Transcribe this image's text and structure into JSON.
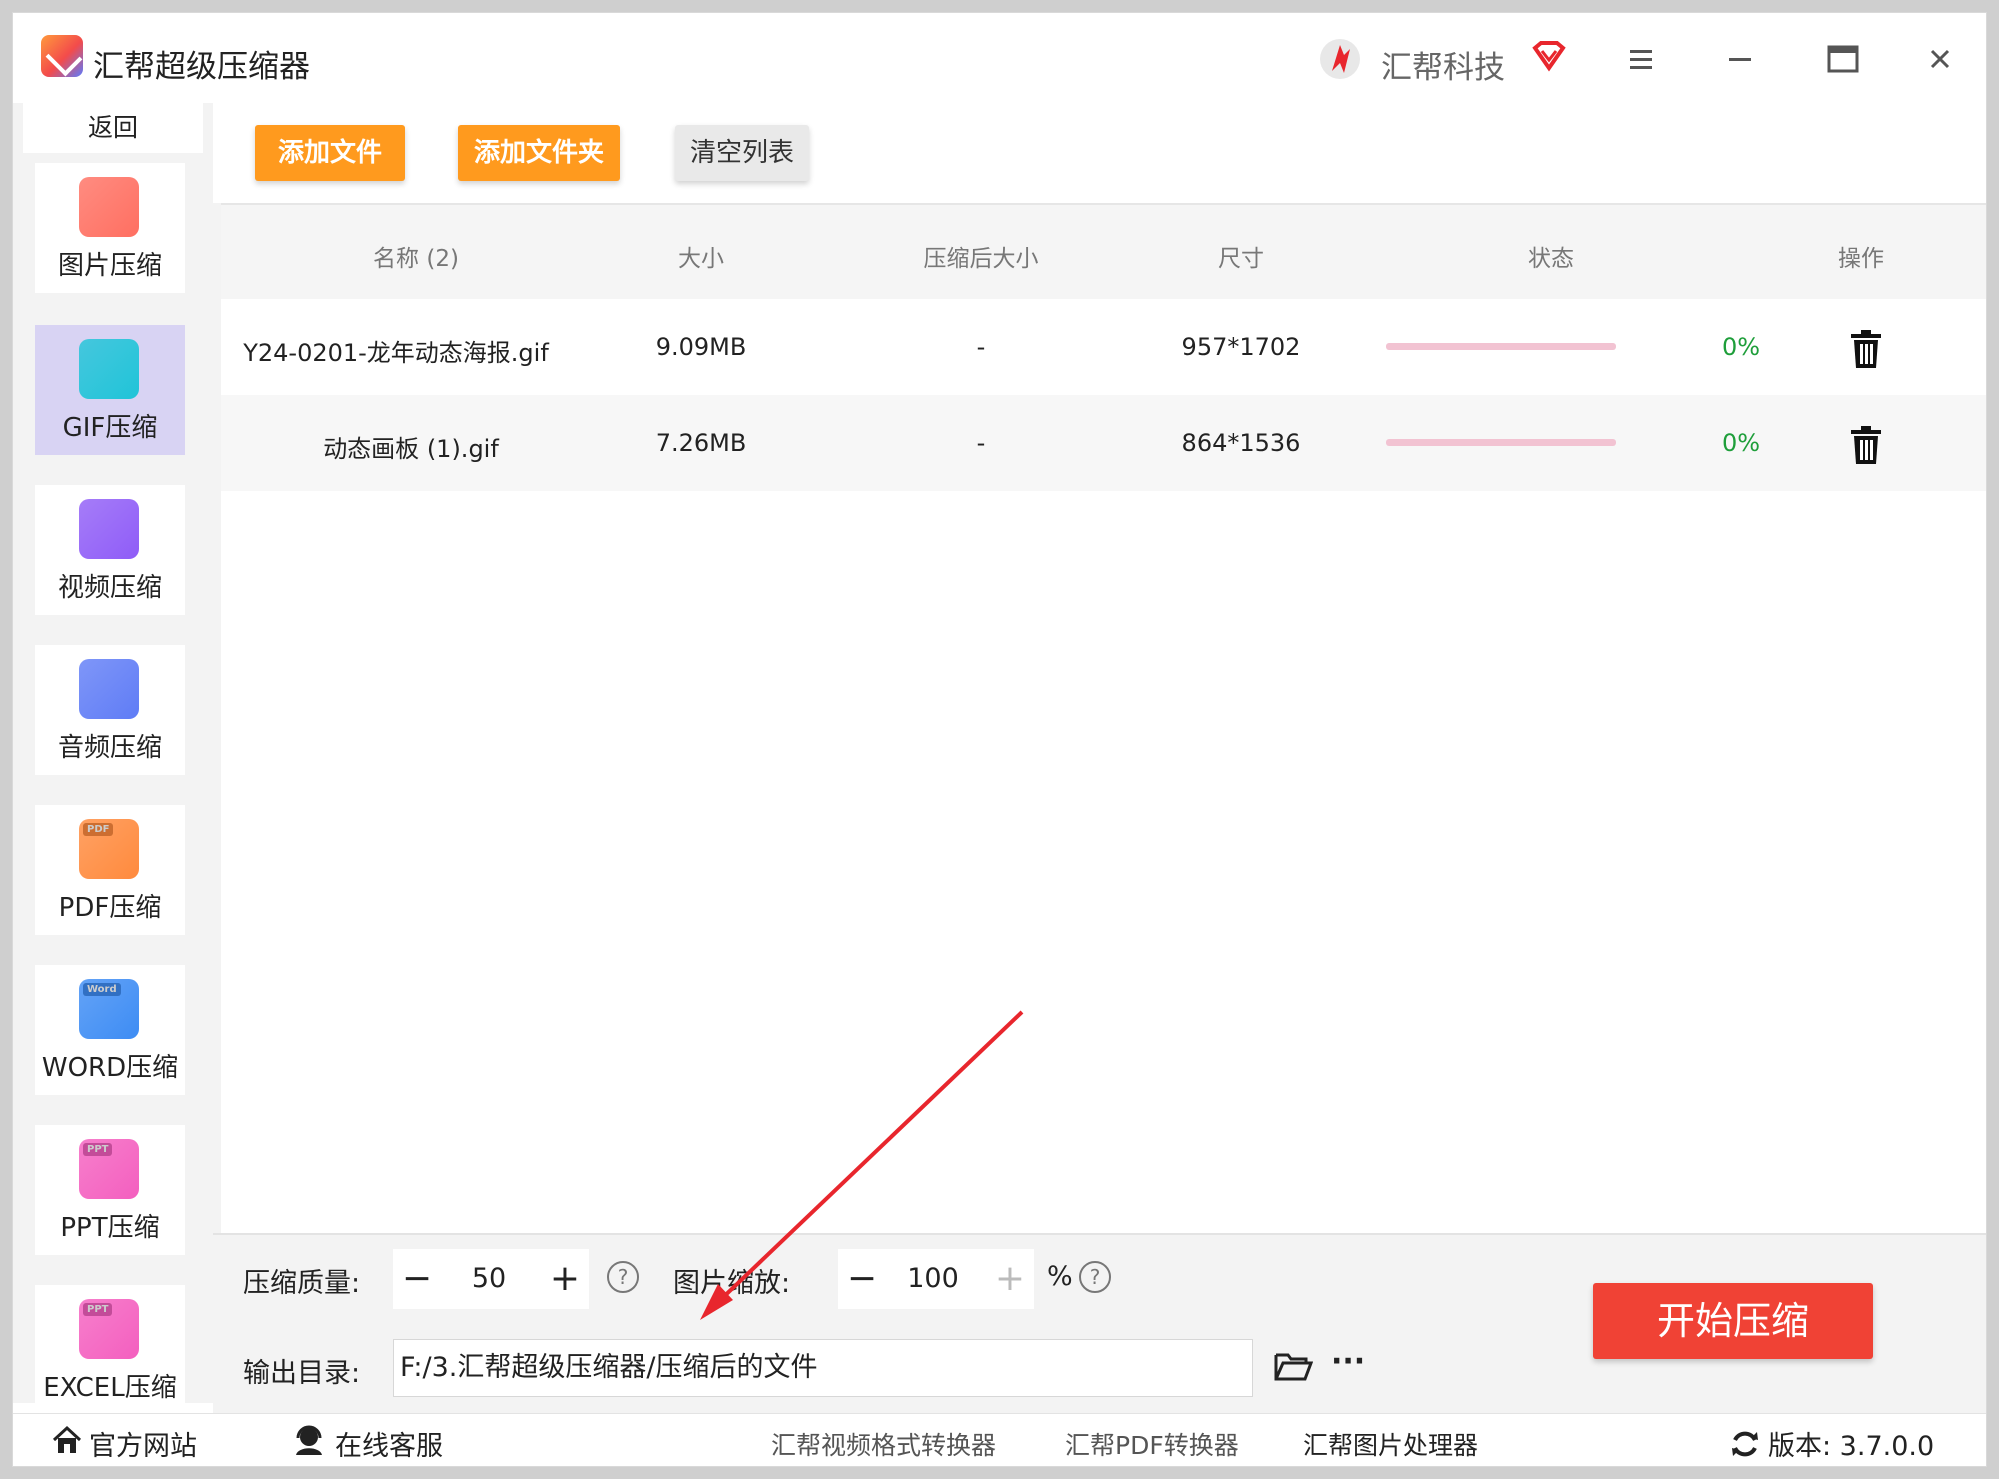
{
  "app": {
    "title": "汇帮超级压缩器",
    "brand": "汇帮科技"
  },
  "sidebar": {
    "back_label": "返回",
    "items": [
      {
        "label": "图片压缩",
        "icon": "image-icon",
        "color": "#ff6f61"
      },
      {
        "label": "GIF压缩",
        "icon": "gif-icon",
        "color": "#20c4d8",
        "active": true
      },
      {
        "label": "视频压缩",
        "icon": "video-play-icon",
        "color": "#8f5cf7"
      },
      {
        "label": "音频压缩",
        "icon": "audio-icon",
        "color": "#5f7cf6"
      },
      {
        "label": "PDF压缩",
        "icon": "pdf-folder-icon",
        "color": "#ff8a3d",
        "tag": "PDF"
      },
      {
        "label": "WORD压缩",
        "icon": "word-folder-icon",
        "color": "#3d8cf4",
        "tag": "Word"
      },
      {
        "label": "PPT压缩",
        "icon": "ppt-folder-icon",
        "color": "#f45fbf",
        "tag": "PPT"
      },
      {
        "label": "EXCEL压缩",
        "icon": "excel-folder-icon",
        "color": "#f45fbf",
        "tag": "PPT"
      }
    ]
  },
  "toolbar": {
    "add_file": "添加文件",
    "add_folder": "添加文件夹",
    "clear_list": "清空列表"
  },
  "table": {
    "headers": {
      "name": "名称 (2)",
      "size": "大小",
      "compressed_size": "压缩后大小",
      "dimensions": "尺寸",
      "status": "状态",
      "action": "操作"
    },
    "rows": [
      {
        "name": "Y24-0201-龙年动态海报.gif",
        "size": "9.09MB",
        "compressed_size": "-",
        "dimensions": "957*1702",
        "progress_pct": "0%"
      },
      {
        "name": "动态画板 (1).gif",
        "size": "7.26MB",
        "compressed_size": "-",
        "dimensions": "864*1536",
        "progress_pct": "0%"
      }
    ]
  },
  "settings": {
    "quality_label": "压缩质量:",
    "quality_value": "50",
    "scale_label": "图片缩放:",
    "scale_value": "100",
    "scale_unit": "%",
    "output_label": "输出目录:",
    "output_path": "F:/3.汇帮超级压缩器/压缩后的文件",
    "start_label": "开始压缩"
  },
  "footer": {
    "website": "官方网站",
    "support": "在线客服",
    "link_video": "汇帮视频格式转换器",
    "link_pdf": "汇帮PDF转换器",
    "link_image": "汇帮图片处理器",
    "version": "版本:  3.7.0.0"
  },
  "colors": {
    "accent_orange": "#ff9a1e",
    "start_red": "#f04235",
    "progress_pink": "#f2c3d2",
    "status_green": "#1e9e3a",
    "active_nav": "#d8d3f3"
  }
}
